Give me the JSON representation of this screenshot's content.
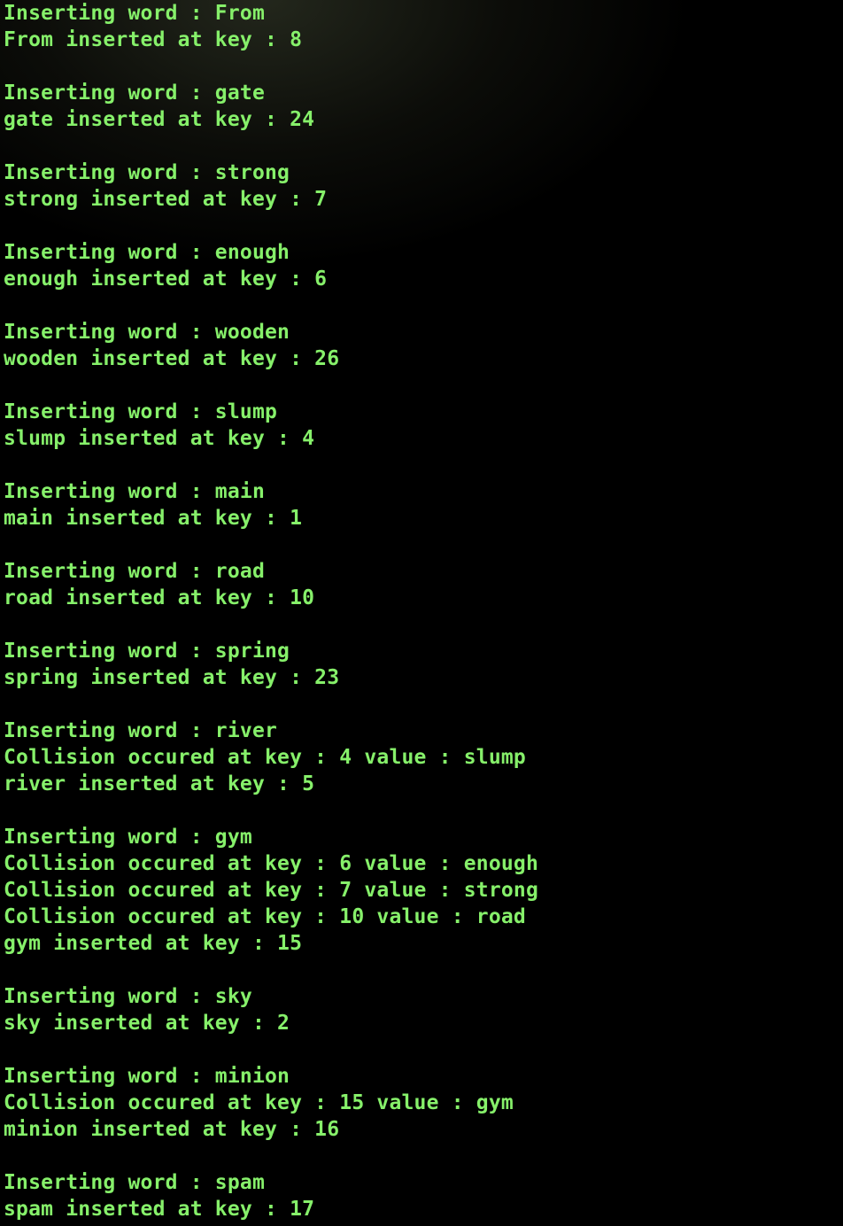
{
  "terminal": {
    "lines": [
      "Inserting word : From",
      "From inserted at key : 8",
      "",
      "Inserting word : gate",
      "gate inserted at key : 24",
      "",
      "Inserting word : strong",
      "strong inserted at key : 7",
      "",
      "Inserting word : enough",
      "enough inserted at key : 6",
      "",
      "Inserting word : wooden",
      "wooden inserted at key : 26",
      "",
      "Inserting word : slump",
      "slump inserted at key : 4",
      "",
      "Inserting word : main",
      "main inserted at key : 1",
      "",
      "Inserting word : road",
      "road inserted at key : 10",
      "",
      "Inserting word : spring",
      "spring inserted at key : 23",
      "",
      "Inserting word : river",
      "Collision occured at key : 4 value : slump",
      "river inserted at key : 5",
      "",
      "Inserting word : gym",
      "Collision occured at key : 6 value : enough",
      "Collision occured at key : 7 value : strong",
      "Collision occured at key : 10 value : road",
      "gym inserted at key : 15",
      "",
      "Inserting word : sky",
      "sky inserted at key : 2",
      "",
      "Inserting word : minion",
      "Collision occured at key : 15 value : gym",
      "minion inserted at key : 16",
      "",
      "Inserting word : spam",
      "spam inserted at key : 17"
    ],
    "text_color": "#86f06a",
    "background_color": "#000000"
  }
}
